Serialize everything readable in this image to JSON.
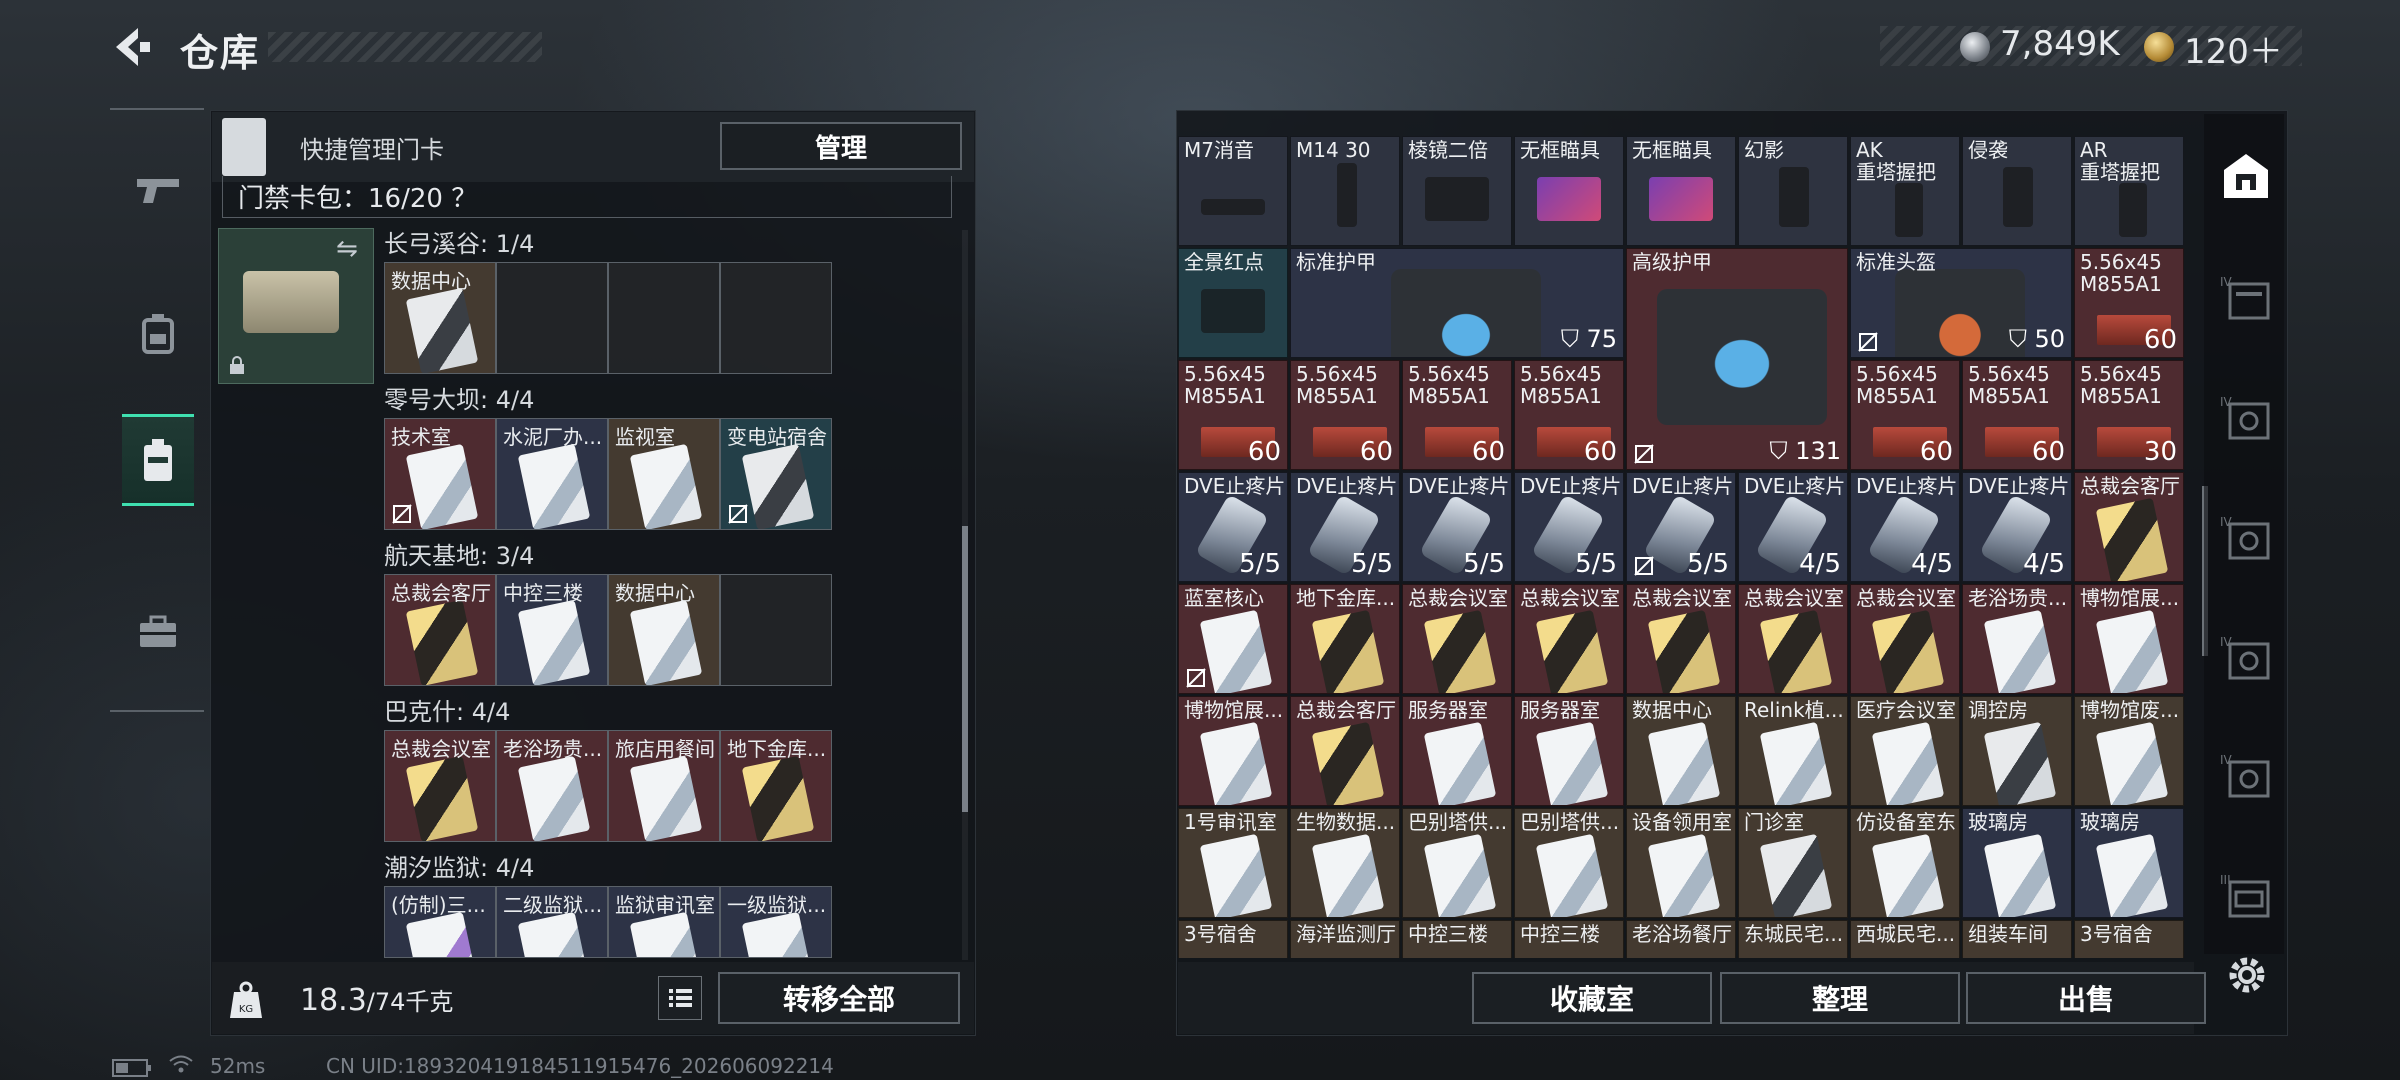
{
  "header": {
    "title": "仓库",
    "currency": [
      {
        "icon": "silver-coin-icon",
        "value": "7,849K"
      },
      {
        "icon": "gold-coin-icon",
        "value": "120＋"
      }
    ]
  },
  "left_panel": {
    "header_label": "快捷管理门卡",
    "manage_label": "管理",
    "card_pack": "门禁卡包：16/20 ？",
    "regions": [
      {
        "title": "长弓溪谷: 1/4",
        "slots": [
          "数据中心",
          "",
          "",
          ""
        ]
      },
      {
        "title": "零号大坝: 4/4",
        "slots": [
          "技术室",
          "水泥厂办...",
          "监视室",
          "变电站宿舍"
        ]
      },
      {
        "title": "航天基地: 3/4",
        "slots": [
          "总裁会客厅",
          "中控三楼",
          "数据中心",
          ""
        ]
      },
      {
        "title": "巴克什: 4/4",
        "slots": [
          "总裁会议室",
          "老浴场贵...",
          "旅店用餐间",
          "地下金库..."
        ]
      },
      {
        "title": "潮汐监狱: 4/4",
        "slots": [
          "(仿制)三...",
          "二级监狱...",
          "监狱审讯室",
          "一级监狱..."
        ]
      }
    ],
    "weight_value": "18.3",
    "weight_max": "/74千克",
    "transfer_label": "转移全部"
  },
  "status": {
    "ping": "52ms",
    "uid": "CN UID:18932041918451​1915476_202606092214"
  },
  "right_panel": {
    "row1": [
      "M7消音",
      "M14 30",
      "棱镜二倍",
      "无框瞄具",
      "无框瞄具",
      "幻影",
      "AK\n重塔握把",
      "侵袭",
      "AR\n重塔握把"
    ],
    "row2": {
      "c1": "全景红点",
      "armor1": {
        "label": "标准护甲",
        "value": "75"
      },
      "armor2": {
        "label": "高级护甲",
        "value": "131"
      },
      "helmet": {
        "label": "标准头盔",
        "value": "50"
      },
      "ammo": {
        "label": "5.56x45\nM855A1",
        "qty": "60"
      }
    },
    "row3_ammo": [
      {
        "label": "5.56x45\nM855A1",
        "qty": "60"
      },
      {
        "label": "5.56x45\nM855A1",
        "qty": "60"
      },
      {
        "label": "5.56x45\nM855A1",
        "qty": "60"
      },
      {
        "label": "5.56x45\nM855A1",
        "qty": "60"
      },
      {
        "label": "5.56x45\nM855A1",
        "qty": "60"
      },
      {
        "label": "5.56x45\nM855A1",
        "qty": "60"
      },
      {
        "label": "5.56x45\nM855A1",
        "qty": "30"
      }
    ],
    "row4": [
      {
        "label": "DVE止疼片",
        "qty": "5/5"
      },
      {
        "label": "DVE止疼片",
        "qty": "5/5"
      },
      {
        "label": "DVE止疼片",
        "qty": "5/5"
      },
      {
        "label": "DVE止疼片",
        "qty": "5/5"
      },
      {
        "label": "DVE止疼片",
        "qty": "5/5"
      },
      {
        "label": "DVE止疼片",
        "qty": "4/5"
      },
      {
        "label": "DVE止疼片",
        "qty": "4/5"
      },
      {
        "label": "DVE止疼片",
        "qty": "4/5"
      },
      {
        "label": "总裁会客厅",
        "qty": ""
      }
    ],
    "row5": [
      "蓝室核心",
      "地下金库...",
      "总裁会议室",
      "总裁会议室",
      "总裁会议室",
      "总裁会议室",
      "总裁会议室",
      "老浴场贵...",
      "博物馆展..."
    ],
    "row6": [
      "博物馆展...",
      "总裁会客厅",
      "服务器室",
      "服务器室",
      "数据中心",
      "Relink植...",
      "医疗会议室",
      "调控房",
      "博物馆废..."
    ],
    "row7": [
      "1号审讯室",
      "生物数据...",
      "巴别塔供...",
      "巴别塔供...",
      "设备领用室",
      "门诊室",
      "仿设备室东",
      "玻璃房",
      "玻璃房"
    ],
    "row8": [
      "3号宿舍",
      "海洋监测厅",
      "中控三楼",
      "中控三楼",
      "老浴场餐厅",
      "东城民宅...",
      "西城民宅...",
      "组装车间",
      "3号宿舍"
    ],
    "buttons": {
      "collection": "收藏室",
      "sort": "整理",
      "sell": "出售"
    }
  }
}
